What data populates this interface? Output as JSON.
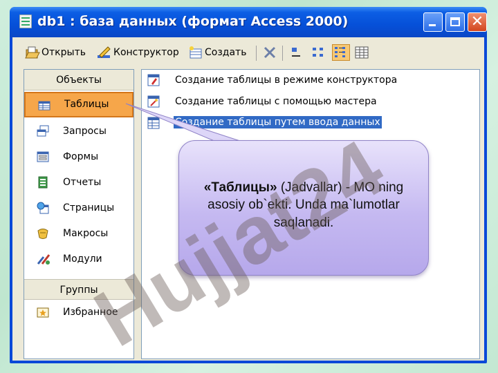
{
  "window": {
    "title": "db1 : база данных (формат Access 2000)"
  },
  "toolbar": {
    "open_label": "Открыть",
    "design_label": "Конструктор",
    "create_label": "Создать"
  },
  "objects_panel": {
    "header": "Объекты",
    "items": [
      {
        "label": "Таблицы",
        "icon": "table-icon"
      },
      {
        "label": "Запросы",
        "icon": "query-icon"
      },
      {
        "label": "Формы",
        "icon": "form-icon"
      },
      {
        "label": "Отчеты",
        "icon": "report-icon"
      },
      {
        "label": "Страницы",
        "icon": "page-icon"
      },
      {
        "label": "Макросы",
        "icon": "macro-icon"
      },
      {
        "label": "Модули",
        "icon": "module-icon"
      }
    ],
    "groups_header": "Группы",
    "group_items": [
      {
        "label": "Избранное",
        "icon": "favorites-icon"
      }
    ]
  },
  "list": {
    "items": [
      {
        "label": "Создание таблицы в режиме конструктора"
      },
      {
        "label": "Создание таблицы с помощью мастера"
      },
      {
        "label": "Создание таблицы путем ввода данных"
      }
    ]
  },
  "callout": {
    "term": "«Таблицы»",
    "text": " (Jadvallar) - MO ning asosiy ob`ekti. Unda ma`lumotlar saqlanadi."
  },
  "watermark": {
    "text": "Hujjat24"
  },
  "colors": {
    "title_bar": "#0650d8",
    "selection": "#f6a64a",
    "highlight_row": "#316ac5",
    "callout": "#c5b9f1"
  }
}
